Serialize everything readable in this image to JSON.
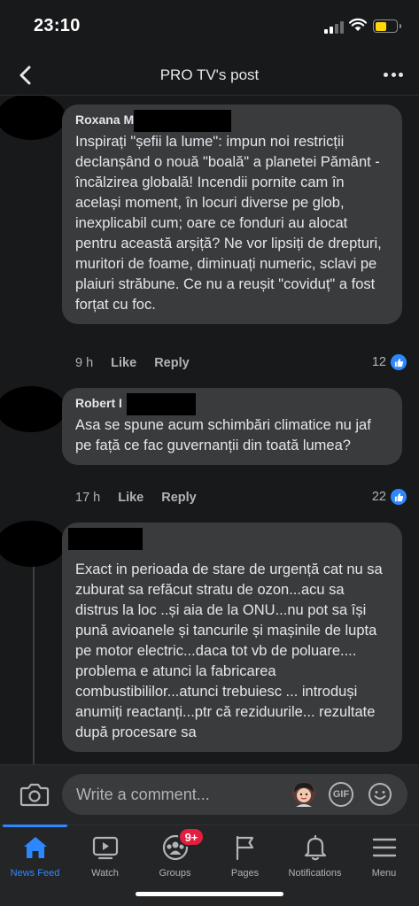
{
  "status_bar": {
    "time": "23:10"
  },
  "header": {
    "title": "PRO TV's post"
  },
  "comments": [
    {
      "author": "Roxana M",
      "text": "Inspirați \"șefii la lume\": impun noi restricții declanșând o nouă \"boală\" a planetei Pământ - încălzirea globală! Incendii pornite cam în același moment, în locuri diverse pe glob, inexplicabil cum; oare ce fonduri au alocat pentru această arșiță? Ne vor lipsiți de drepturi, muritori de foame, diminuați numeric, sclavi pe plaiuri străbune. Ce nu a reușit \"coviduț\" a fost forțat cu foc.",
      "time": "9 h",
      "like_label": "Like",
      "reply_label": "Reply",
      "reactions": "12"
    },
    {
      "author": "Robert I",
      "text": "Asa se spune acum schimbări climatice nu jaf pe față ce fac guvernanții din toată lumea?",
      "time": "17 h",
      "like_label": "Like",
      "reply_label": "Reply",
      "reactions": "22"
    },
    {
      "author": "",
      "text": "Exact in perioada de stare de urgență cat nu sa zuburat sa refăcut stratu de ozon...acu sa distrus la loc ..și aia de la ONU...nu pot sa își pună avioanele și tancurile și mașinile de lupta pe motor electric...daca tot vb de poluare.... problema e atunci la fabricarea combustibililor...atunci trebuiesc ... introduși anumiți reactanți...ptr că reziduurile... rezultate după procesare sa"
    }
  ],
  "composer": {
    "placeholder": "Write a comment...",
    "gif_label": "GIF"
  },
  "tabs": [
    {
      "label": "News Feed",
      "icon": "home-icon",
      "active": true
    },
    {
      "label": "Watch",
      "icon": "watch-icon"
    },
    {
      "label": "Groups",
      "icon": "groups-icon",
      "badge": "9+"
    },
    {
      "label": "Pages",
      "icon": "flag-icon"
    },
    {
      "label": "Notifications",
      "icon": "bell-icon"
    },
    {
      "label": "Menu",
      "icon": "menu-icon"
    }
  ],
  "colors": {
    "background": "#18191a",
    "bubble": "#3a3b3c",
    "accent": "#2d88ff",
    "badge": "#e41e3f"
  }
}
